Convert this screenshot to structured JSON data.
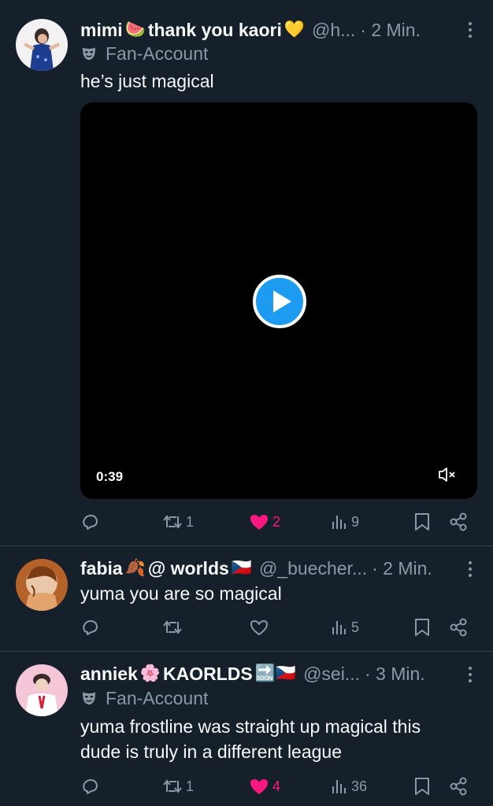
{
  "tweets": [
    {
      "name": "mimi",
      "name_emoji_1": "🍉",
      "name_part2": "thank you kaori",
      "name_emoji_2": "💛",
      "handle": "@h...",
      "time": "· 2 Min.",
      "label": "Fan-Account",
      "text": "he’s just magical",
      "video": {
        "duration": "0:39"
      },
      "actions": {
        "reply": "",
        "retweet": "1",
        "like": "2",
        "views": "9"
      }
    },
    {
      "name": "fabia",
      "name_emoji_1": "🍂",
      "name_part2": "@ worlds",
      "name_emoji_2": "🇨🇿",
      "handle": "@_buecher...",
      "time": "· 2 Min.",
      "text": "yuma you are so magical",
      "actions": {
        "reply": "",
        "retweet": "",
        "like": "",
        "views": "5"
      }
    },
    {
      "name": "anniek",
      "name_emoji_1": "🌸",
      "name_part2": "KAORLDS",
      "name_emoji_2": "🔜🇨🇿",
      "handle": "@sei...",
      "time": "· 3 Min.",
      "label": "Fan-Account",
      "text": "yuma frostline was straight up magical this dude is truly in a different league",
      "actions": {
        "reply": "",
        "retweet": "1",
        "like": "4",
        "views": "36"
      }
    }
  ],
  "colors": {
    "background": "#15202b",
    "muted": "#8b98a5",
    "like": "#f91880",
    "accent": "#1d9bf0",
    "divider": "#38444d"
  }
}
